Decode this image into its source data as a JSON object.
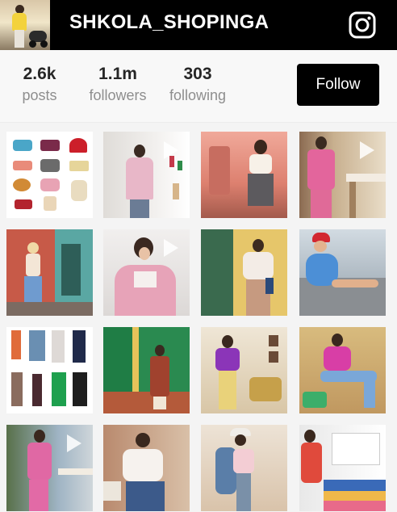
{
  "profile": {
    "username": "SHKOLA_SHOPINGA",
    "avatar_icon": "profile-avatar",
    "platform_icon": "instagram-icon"
  },
  "stats": [
    {
      "value": "2.6k",
      "label": "posts"
    },
    {
      "value": "1.1m",
      "label": "followers"
    },
    {
      "value": "303",
      "label": "following"
    }
  ],
  "actions": {
    "follow_label": "Follow"
  },
  "colors": {
    "header_bg": "#000000",
    "button_bg": "#000000",
    "stat_number": "#262626",
    "stat_label": "#8e8e8e"
  },
  "grid": {
    "rows": 4,
    "columns": 4,
    "posts": [
      {
        "subject": "handbags-flatlay",
        "video": false
      },
      {
        "subject": "pink-blazer-outfit",
        "video": true
      },
      {
        "subject": "white-top-street",
        "video": false
      },
      {
        "subject": "pink-suit-cafe",
        "video": true
      },
      {
        "subject": "flared-jeans-street",
        "video": false
      },
      {
        "subject": "floral-jacket-closeup",
        "video": true
      },
      {
        "subject": "sweater-green-shutters",
        "video": false
      },
      {
        "subject": "blue-swimsuit-beach",
        "video": false
      },
      {
        "subject": "clothing-flatlay",
        "video": false
      },
      {
        "subject": "green-door-dress",
        "video": false
      },
      {
        "subject": "purple-top-room",
        "video": false
      },
      {
        "subject": "pink-sweater-sitting",
        "video": false
      },
      {
        "subject": "pink-suit-terrace",
        "video": true
      },
      {
        "subject": "white-blouse-jeans",
        "video": false
      },
      {
        "subject": "hat-denim-jacket",
        "video": false
      },
      {
        "subject": "striped-fabrics",
        "video": false
      }
    ]
  }
}
